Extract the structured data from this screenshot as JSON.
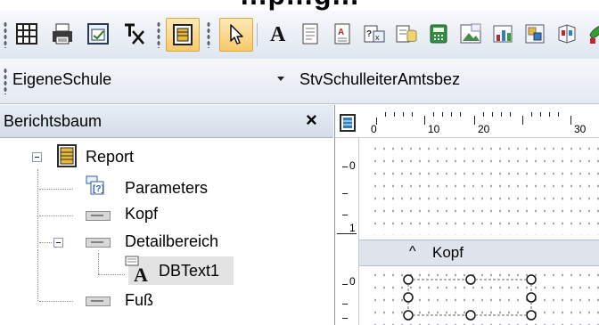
{
  "heading": "…p…g…",
  "toolbar": {
    "icons": [
      "report-table-icon",
      "printer-icon",
      "preview-icon",
      "text-format-icon",
      "panel-icon",
      "pointer-icon",
      "label-a-icon",
      "memo-icon",
      "rich-text-icon",
      "variable-icon",
      "calc-icon",
      "image-icon",
      "chart-icon"
    ]
  },
  "combo": {
    "dataset": "EigeneSchule",
    "field": "StvSchulleiterAmtsbez"
  },
  "tree": {
    "title": "Berichtsbaum",
    "close": "×",
    "items": {
      "report": "Report",
      "parameters": "Parameters",
      "kopf": "Kopf",
      "detail": "Detailbereich",
      "dbtext": "DBText1",
      "fuss": "Fuß"
    }
  },
  "designer": {
    "ruler_top": [
      "0",
      "10",
      "20",
      "30"
    ],
    "ruler_left": [
      "0",
      "1",
      "0"
    ],
    "band": {
      "caret": "^",
      "label": "Kopf"
    }
  },
  "colors": {
    "accent_active": "#f7c96a",
    "toolbar_bg": "#e8edf4",
    "band_bg": "#dfe4ec"
  }
}
